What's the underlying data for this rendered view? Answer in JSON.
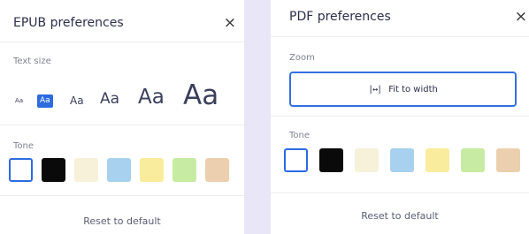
{
  "epub": {
    "title": "EPUB preferences",
    "close_icon": "×",
    "text_size_label": "Text size",
    "text_sizes": [
      "Aa",
      "Aa",
      "Aa",
      "Aa",
      "Aa",
      "Aa"
    ],
    "selected_text_size_index": 1,
    "tone_label": "Tone",
    "tones": [
      "#ffffff",
      "#0a0a0a",
      "#f7f1d9",
      "#a7d1ee",
      "#f9ec9c",
      "#c7eba2",
      "#eccfae"
    ],
    "selected_tone_index": 0,
    "reset_label": "Reset to default"
  },
  "pdf": {
    "title": "PDF preferences",
    "close_icon": "×",
    "zoom_label": "Zoom",
    "zoom_button_label": "Fit to width",
    "zoom_button_icon": "fit-width-icon",
    "tone_label": "Tone",
    "tones": [
      "#ffffff",
      "#0a0a0a",
      "#f7f1d9",
      "#a7d1ee",
      "#f9ec9c",
      "#c7eba2",
      "#eccfae"
    ],
    "selected_tone_index": 0,
    "reset_label": "Reset to default"
  },
  "colors": {
    "accent": "#2d6be0",
    "background": "#e9e6f7"
  }
}
